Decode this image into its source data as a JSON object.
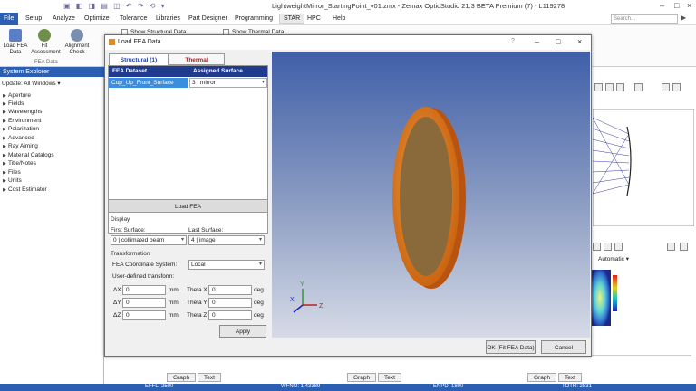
{
  "app": {
    "title": "LightweightMirror_StartingPoint_v01.zmx - Zemax OpticStudio 21.3  BETA  Premium (7) - L119278"
  },
  "menu": {
    "file": "File",
    "items": [
      "Setup",
      "Analyze",
      "Optimize",
      "Tolerance",
      "Libraries",
      "Part Designer",
      "Programming",
      "STAR",
      "HPC",
      "Help"
    ],
    "search_placeholder": "Search..."
  },
  "ribbon": {
    "load_fea": "Load FEA Data",
    "fit_assessment": "Fit Assessment",
    "alignment_check": "Alignment Check",
    "group_label": "FEA Data",
    "show_structural": "Show Structural Data",
    "show_thermal": "Show Thermal Data"
  },
  "explorer": {
    "header": "System Explorer",
    "update": "Update: All Windows",
    "items": [
      "Aperture",
      "Fields",
      "Wavelengths",
      "Environment",
      "Polarization",
      "Advanced",
      "Ray Aiming",
      "Material Catalogs",
      "Title/Notes",
      "Files",
      "Units",
      "Cost Estimator"
    ]
  },
  "dialog": {
    "title": "Load FEA Data",
    "help": "?",
    "tabs": [
      "Structural (1)",
      "Thermal"
    ],
    "table": {
      "col_dataset": "FEA Dataset",
      "col_surface": "Assigned Surface",
      "dataset": "Cup_Up_Front_Surface",
      "surface": "3 | mirror"
    },
    "load_button": "Load FEA",
    "display_label": "Display",
    "first_surface_label": "First Surface:",
    "first_surface_value": "0 | collimated beam",
    "last_surface_label": "Last Surface:",
    "last_surface_value": "4 | image",
    "transformation_label": "Transformation",
    "coord_system_label": "FEA Coordinate System:",
    "coord_system_value": "Local",
    "user_transform_label": "User-defined transform:",
    "dx_label": "ΔX",
    "dy_label": "ΔY",
    "dz_label": "ΔZ",
    "dx": "0",
    "dy": "0",
    "dz": "0",
    "mm_unit": "mm",
    "tx_label": "Theta X",
    "ty_label": "Theta Y",
    "tz_label": "Theta Z",
    "tx": "0",
    "ty": "0",
    "tz": "0",
    "deg_unit": "deg",
    "apply": "Apply",
    "ok": "OK (Fit FEA Data)",
    "cancel": "Cancel",
    "axis_x": "X",
    "axis_y": "Y",
    "axis_z": "Z"
  },
  "right": {
    "automatic": "Automatic"
  },
  "bottom": {
    "graph": "Graph",
    "text": "Text"
  },
  "status": {
    "effl": "EFFL: 2500",
    "wfno": "WFNO: 1.43389",
    "enpd": "ENPD: 1800",
    "totr": "TOTR: 2831"
  },
  "colors": {
    "accent": "#2b5fb3",
    "table_header": "#1f3a8f",
    "selected_cell": "#3a8ee0",
    "viewport_top": "#3f5fa8",
    "viewport_bottom": "#d6dbe6",
    "mirror_rim": "#e07a1a",
    "mirror_face": "#8a6a3a"
  }
}
